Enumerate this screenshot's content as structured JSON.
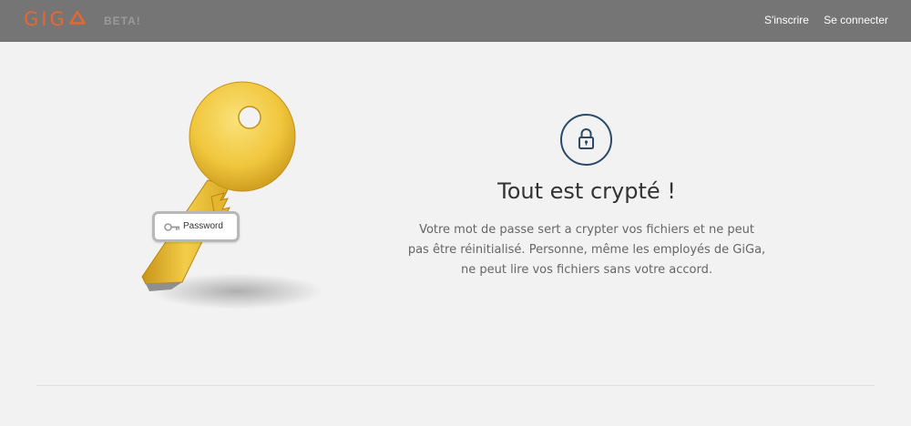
{
  "header": {
    "logo_text": "GIG",
    "beta_label": "BETA!",
    "nav": {
      "signup_label": "S'inscrire",
      "login_label": "Se connecter"
    }
  },
  "hero": {
    "password_tag_label": "Password",
    "title": "Tout est crypté !",
    "description_lines": [
      "Votre mot de passe sert a crypter vos fichiers et ne peut",
      "pas être réinitialisé. Personne, même les employés de GiGa,",
      "ne peut lire vos fichiers sans votre accord."
    ]
  },
  "colors": {
    "brand_orange": "#e8662f",
    "header_bg": "#757575",
    "lock_navy": "#2a4a67",
    "key_gold": "#f0c63c"
  },
  "icons": {
    "key": "key-illustration",
    "lock": "lock-icon",
    "small_key": "key-icon"
  }
}
